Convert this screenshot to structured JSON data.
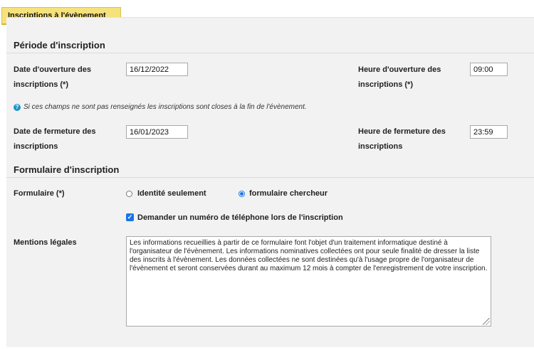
{
  "tab": {
    "label": "Inscriptions à l'évènement"
  },
  "periode": {
    "title": "Période d'inscription",
    "ouverture_date_label_1": "Date d'ouverture des",
    "ouverture_date_label_2": "inscriptions (*)",
    "ouverture_date_value": "16/12/2022",
    "ouverture_heure_label_1": "Heure d'ouverture des",
    "ouverture_heure_label_2": "inscriptions (*)",
    "ouverture_heure_value": "09:00",
    "info": "Si ces champs ne sont pas renseignés les inscriptions sont closes à la fin de l'évènement.",
    "fermeture_date_label_1": "Date de fermeture des",
    "fermeture_date_label_2": "inscriptions",
    "fermeture_date_value": "16/01/2023",
    "fermeture_heure_label_1": "Heure de fermeture des",
    "fermeture_heure_label_2": "inscriptions",
    "fermeture_heure_value": "23:59"
  },
  "formulaire": {
    "title": "Formulaire d'inscription",
    "label": "Formulaire (*)",
    "option_identite": "Identité seulement",
    "option_chercheur": "formulaire chercheur",
    "selected": "formulaire chercheur",
    "telephone_label": "Demander un numéro de téléphone lors de l'inscription",
    "telephone_checked": true,
    "mentions_label": "Mentions légales",
    "mentions_text": "Les informations recueillies à partir de ce formulaire font l'objet d'un traitement informatique destiné à l'organisateur de l'évènement. Les informations nominatives collectées ont pour seule finalité de dresser la liste des inscrits à l'évènement. Les données collectées ne sont destinées qu'à l'usage propre de l'organisateur de l'évènement et seront conservées durant au maximum 12 mois à compter de l'enregistrement de votre inscription."
  },
  "colors": {
    "tab_bg": "#f6e27a",
    "panel_bg": "#f2f2f2",
    "accent": "#1a73e8",
    "info_icon": "#1b95c9"
  },
  "icons": {
    "info": "info-circle-icon",
    "check": "checkmark-icon",
    "resize": "resize-grip-icon"
  }
}
